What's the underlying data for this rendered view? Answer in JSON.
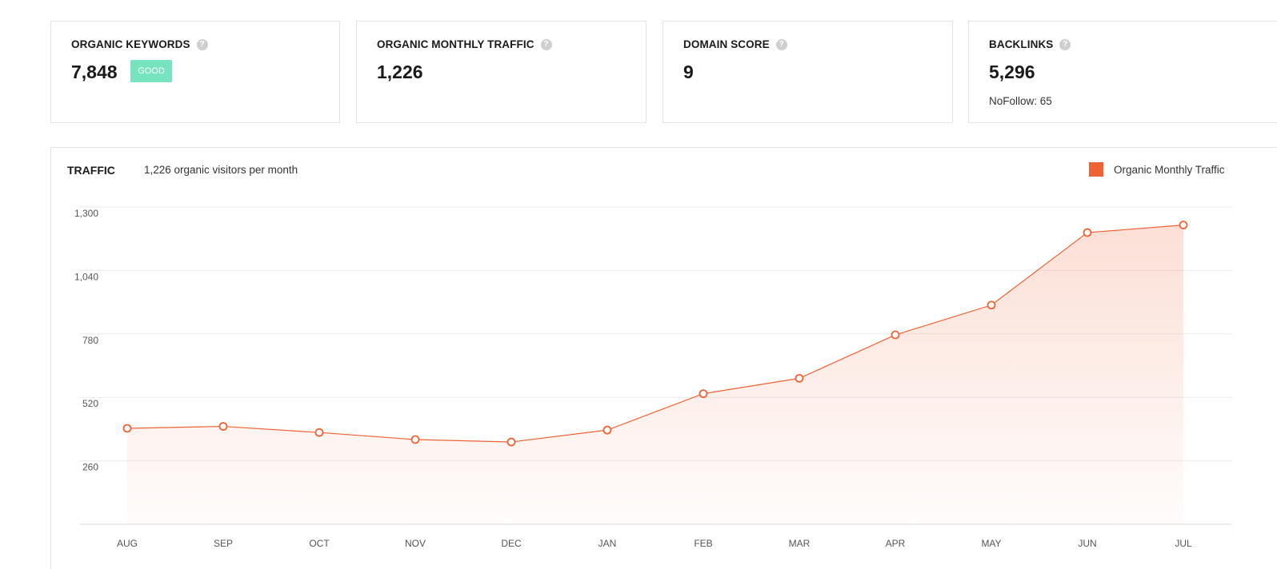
{
  "cards": [
    {
      "label": "ORGANIC KEYWORDS",
      "value": "7,848",
      "badge": "GOOD"
    },
    {
      "label": "ORGANIC MONTHLY TRAFFIC",
      "value": "1,226"
    },
    {
      "label": "DOMAIN SCORE",
      "value": "9"
    },
    {
      "label": "BACKLINKS",
      "value": "5,296",
      "sub": "NoFollow: 65"
    }
  ],
  "help_glyph": "?",
  "traffic": {
    "title": "TRAFFIC",
    "subtitle": "1,226 organic visitors per month",
    "legend": "Organic Monthly Traffic"
  },
  "colors": {
    "series": "#ee6233",
    "badge": "#76e4be",
    "grid": "#ebebeb"
  },
  "chart_data": {
    "type": "area",
    "categories": [
      "AUG",
      "SEP",
      "OCT",
      "NOV",
      "DEC",
      "JAN",
      "FEB",
      "MAR",
      "APR",
      "MAY",
      "JUN",
      "JUL"
    ],
    "series": [
      {
        "name": "Organic Monthly Traffic",
        "values": [
          393,
          401,
          376,
          347,
          337,
          386,
          535,
          598,
          776,
          898,
          1195,
          1226
        ]
      }
    ],
    "yticks": [
      "260",
      "520",
      "780",
      "1,040",
      "1,300"
    ],
    "ylim": [
      0,
      1300
    ],
    "grid": true,
    "legend_position": "top-right"
  }
}
